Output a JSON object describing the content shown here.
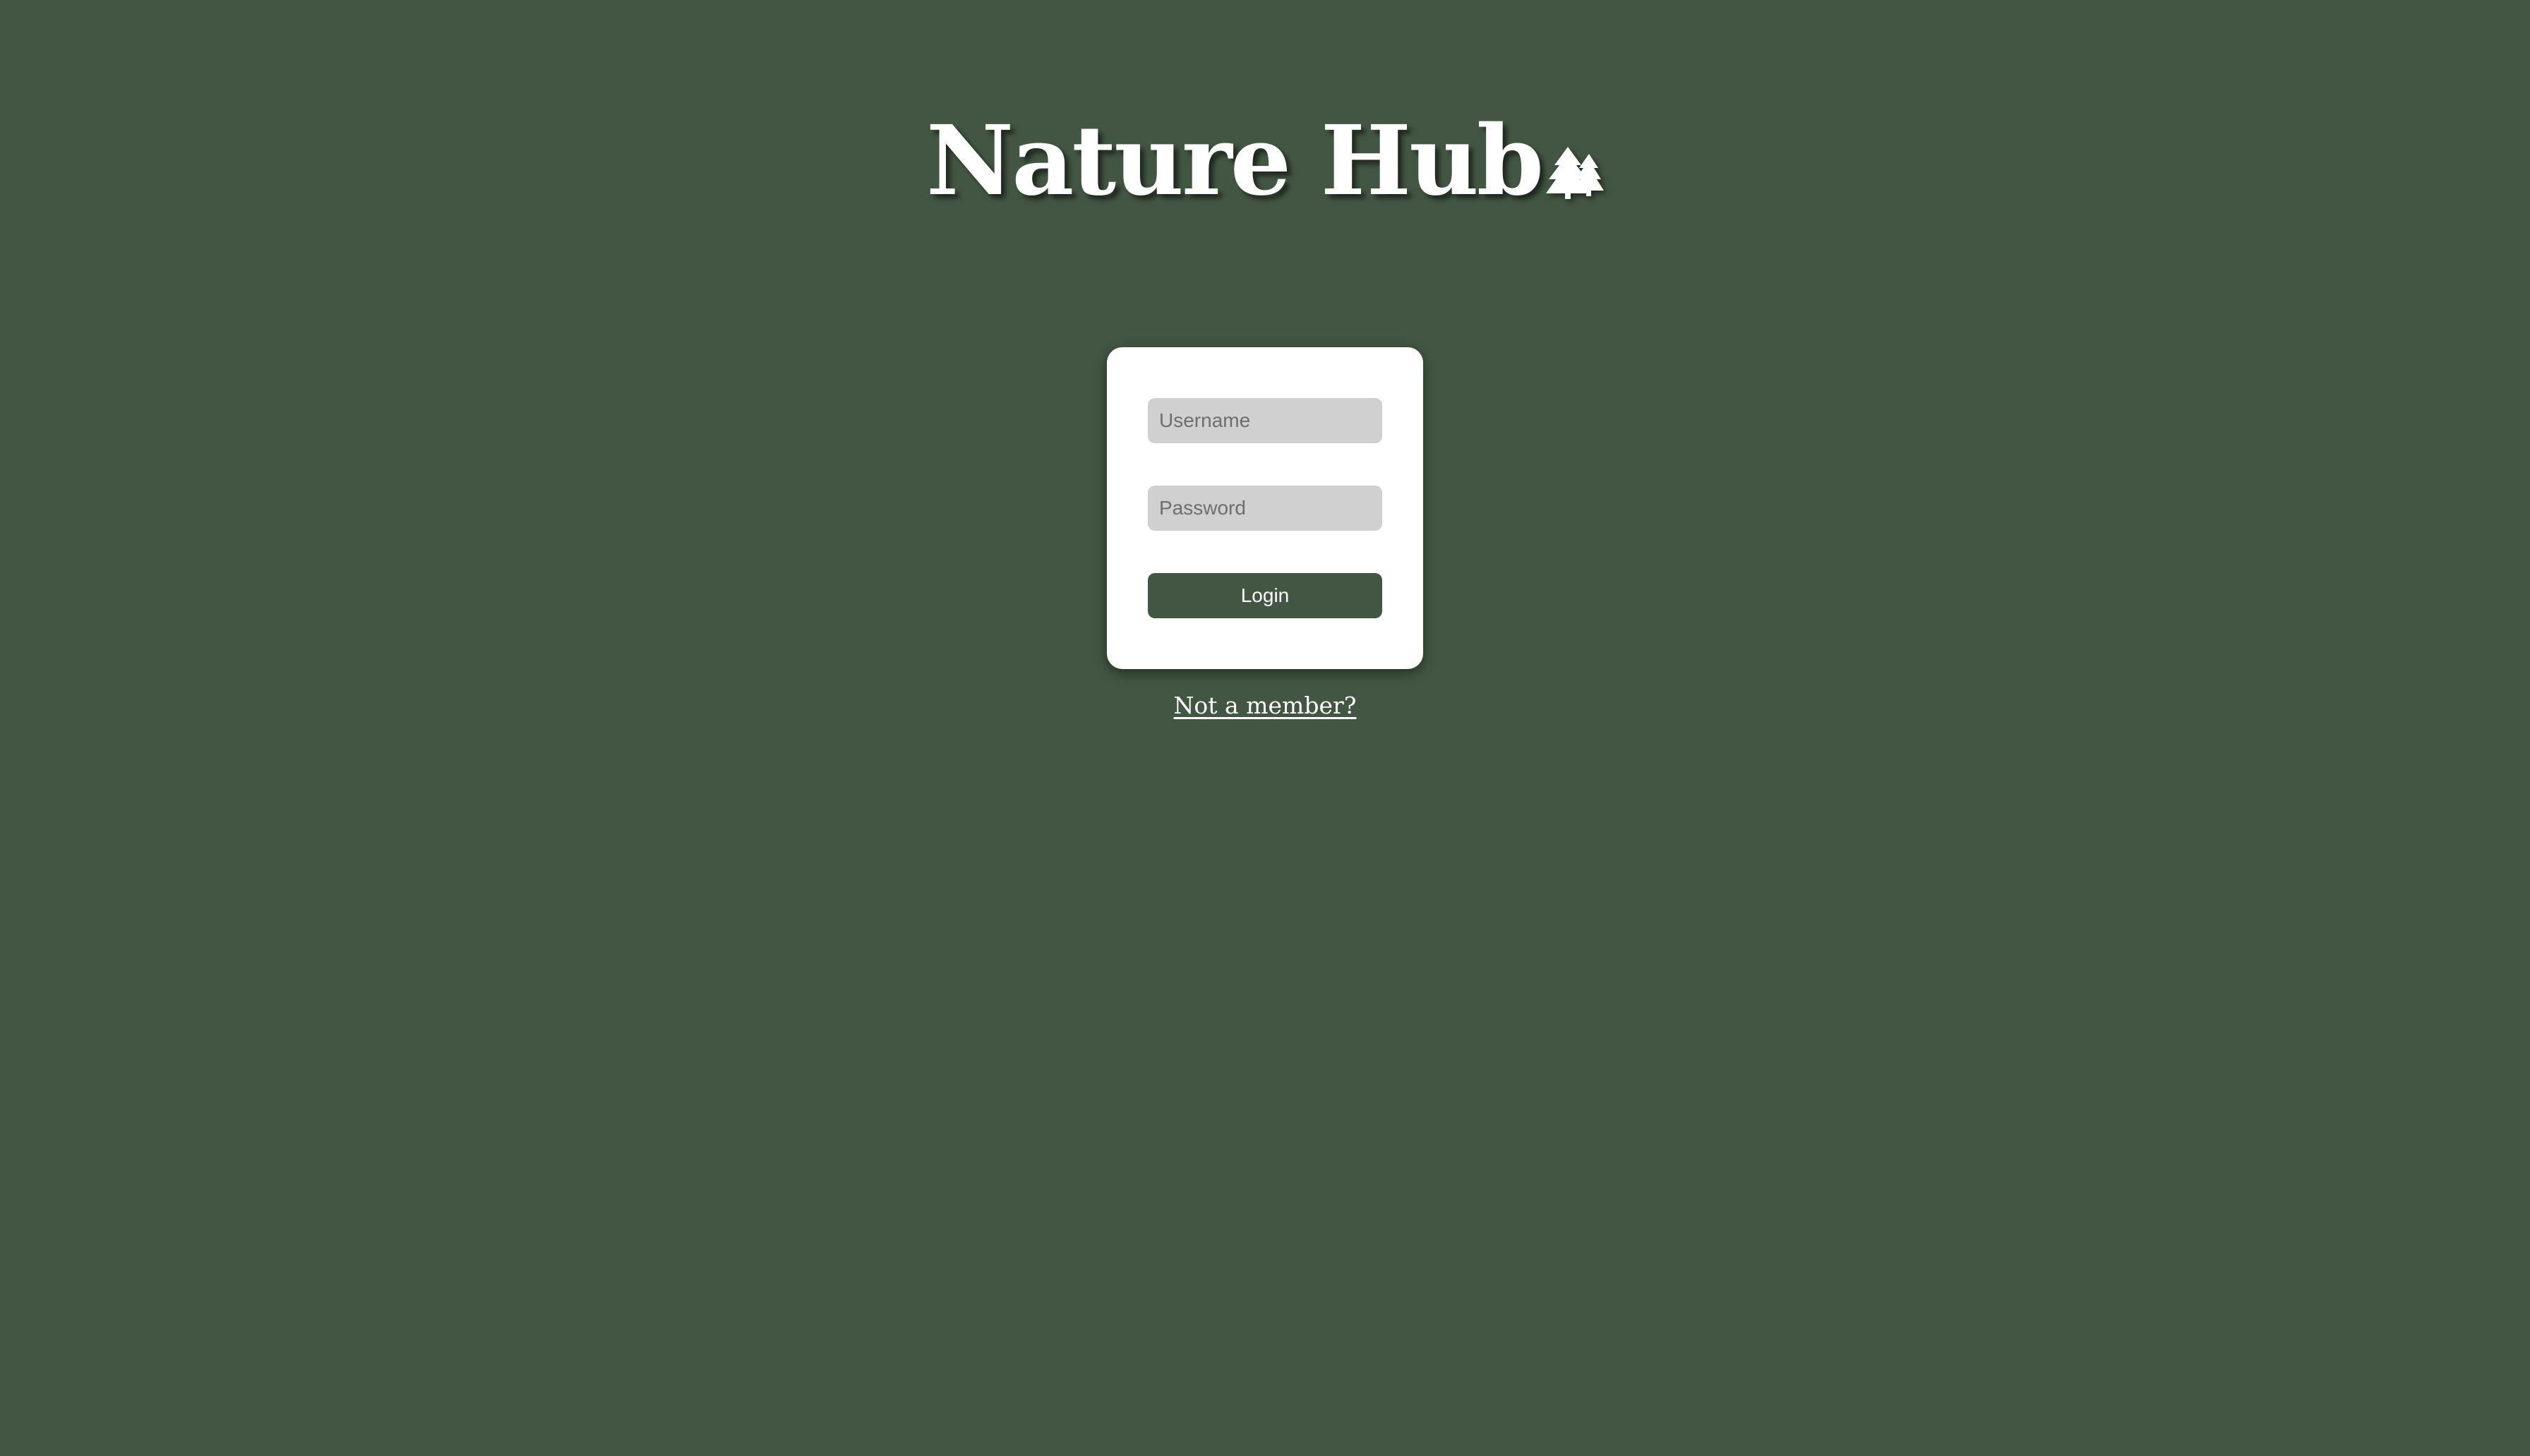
{
  "header": {
    "title": "Nature Hub",
    "logo_icon": "trees-icon"
  },
  "login_form": {
    "username_placeholder": "Username",
    "password_placeholder": "Password",
    "username_value": "",
    "password_value": "",
    "login_label": "Login"
  },
  "footer": {
    "signup_link": "Not a member?"
  },
  "colors": {
    "background": "#435643",
    "card": "#ffffff",
    "input_fill": "#d0d0d0",
    "button": "#435643",
    "text_light": "#ffffff"
  }
}
